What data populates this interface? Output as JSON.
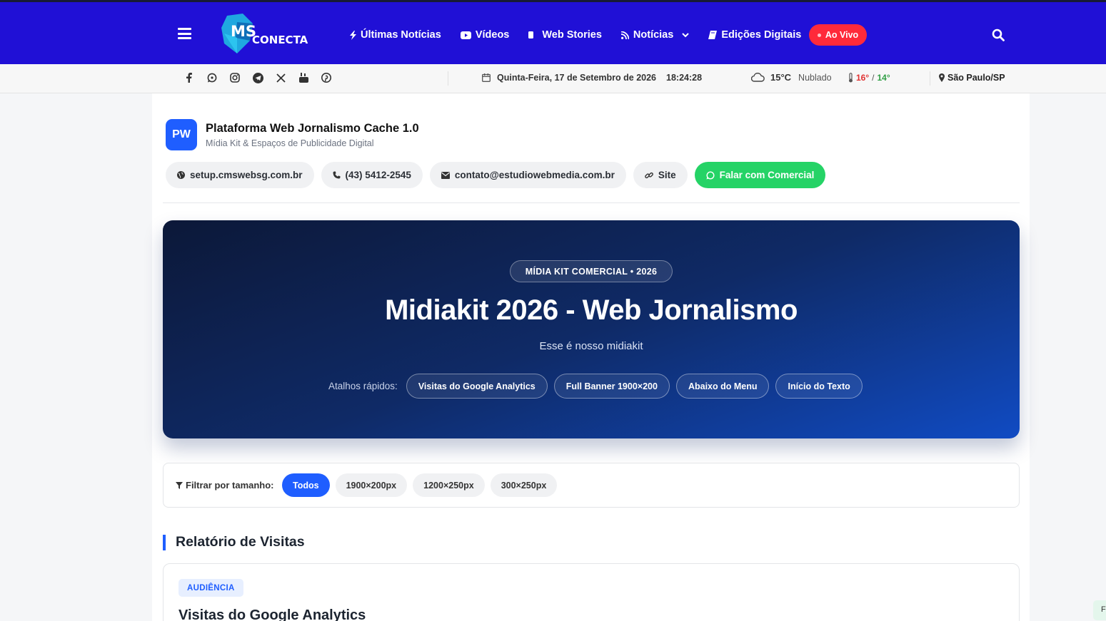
{
  "header": {
    "nav": [
      {
        "label": "Últimas Notícias",
        "icon": "bolt-icon"
      },
      {
        "label": "Vídeos",
        "icon": "youtube-icon"
      },
      {
        "label": "Web Stories",
        "icon": "story-icon"
      },
      {
        "label": "Notícias",
        "icon": "rss-icon"
      },
      {
        "label": "Edições Digitais",
        "icon": "book-icon"
      }
    ],
    "live_label": "Ao Vivo",
    "colors": {
      "bar": "#2010d6",
      "live": "#ff2a3a"
    }
  },
  "infobar": {
    "date": "Quinta-Feira, 17 de Setembro de 2026",
    "time": "18:24:28",
    "temp": "15°C",
    "condition": "Nublado",
    "max": "16°",
    "min": "14°",
    "separator": "/",
    "city": "São Paulo/SP",
    "socials": [
      "facebook-icon",
      "whatsapp-icon",
      "instagram-icon",
      "telegram-icon",
      "x-icon",
      "youtube-icon",
      "pinterest-icon"
    ]
  },
  "brand": {
    "badge": "PW",
    "title": "Plataforma Web Jornalismo Cache 1.0",
    "subtitle": "Mídia Kit & Espaços de Publicidade Digital",
    "contacts": {
      "site_url": "setup.cmswebsg.com.br",
      "phone": "(43) 5412-2545",
      "email": "contato@estudiowebmedia.com.br",
      "site": "Site",
      "commercial": "Falar com Comercial"
    }
  },
  "hero": {
    "tag": "MÍDIA KIT COMERCIAL • 2026",
    "title": "Midiakit 2026 - Web Jornalismo",
    "subtitle": "Esse é nosso midiakit",
    "shortcuts_label": "Atalhos rápidos:",
    "shortcuts": [
      "Visitas do Google Analytics",
      "Full Banner 1900×200",
      "Abaixo do Menu",
      "Início do Texto"
    ]
  },
  "filter": {
    "label": "Filtrar por tamanho:",
    "options": [
      "Todos",
      "1900×200px",
      "1200×250px",
      "300×250px"
    ],
    "active": "Todos"
  },
  "section": {
    "title": "Relatório de Visitas",
    "card_tag": "AUDIÊNCIA",
    "card_title": "Visitas do Google Analytics"
  },
  "float_tab": "F"
}
